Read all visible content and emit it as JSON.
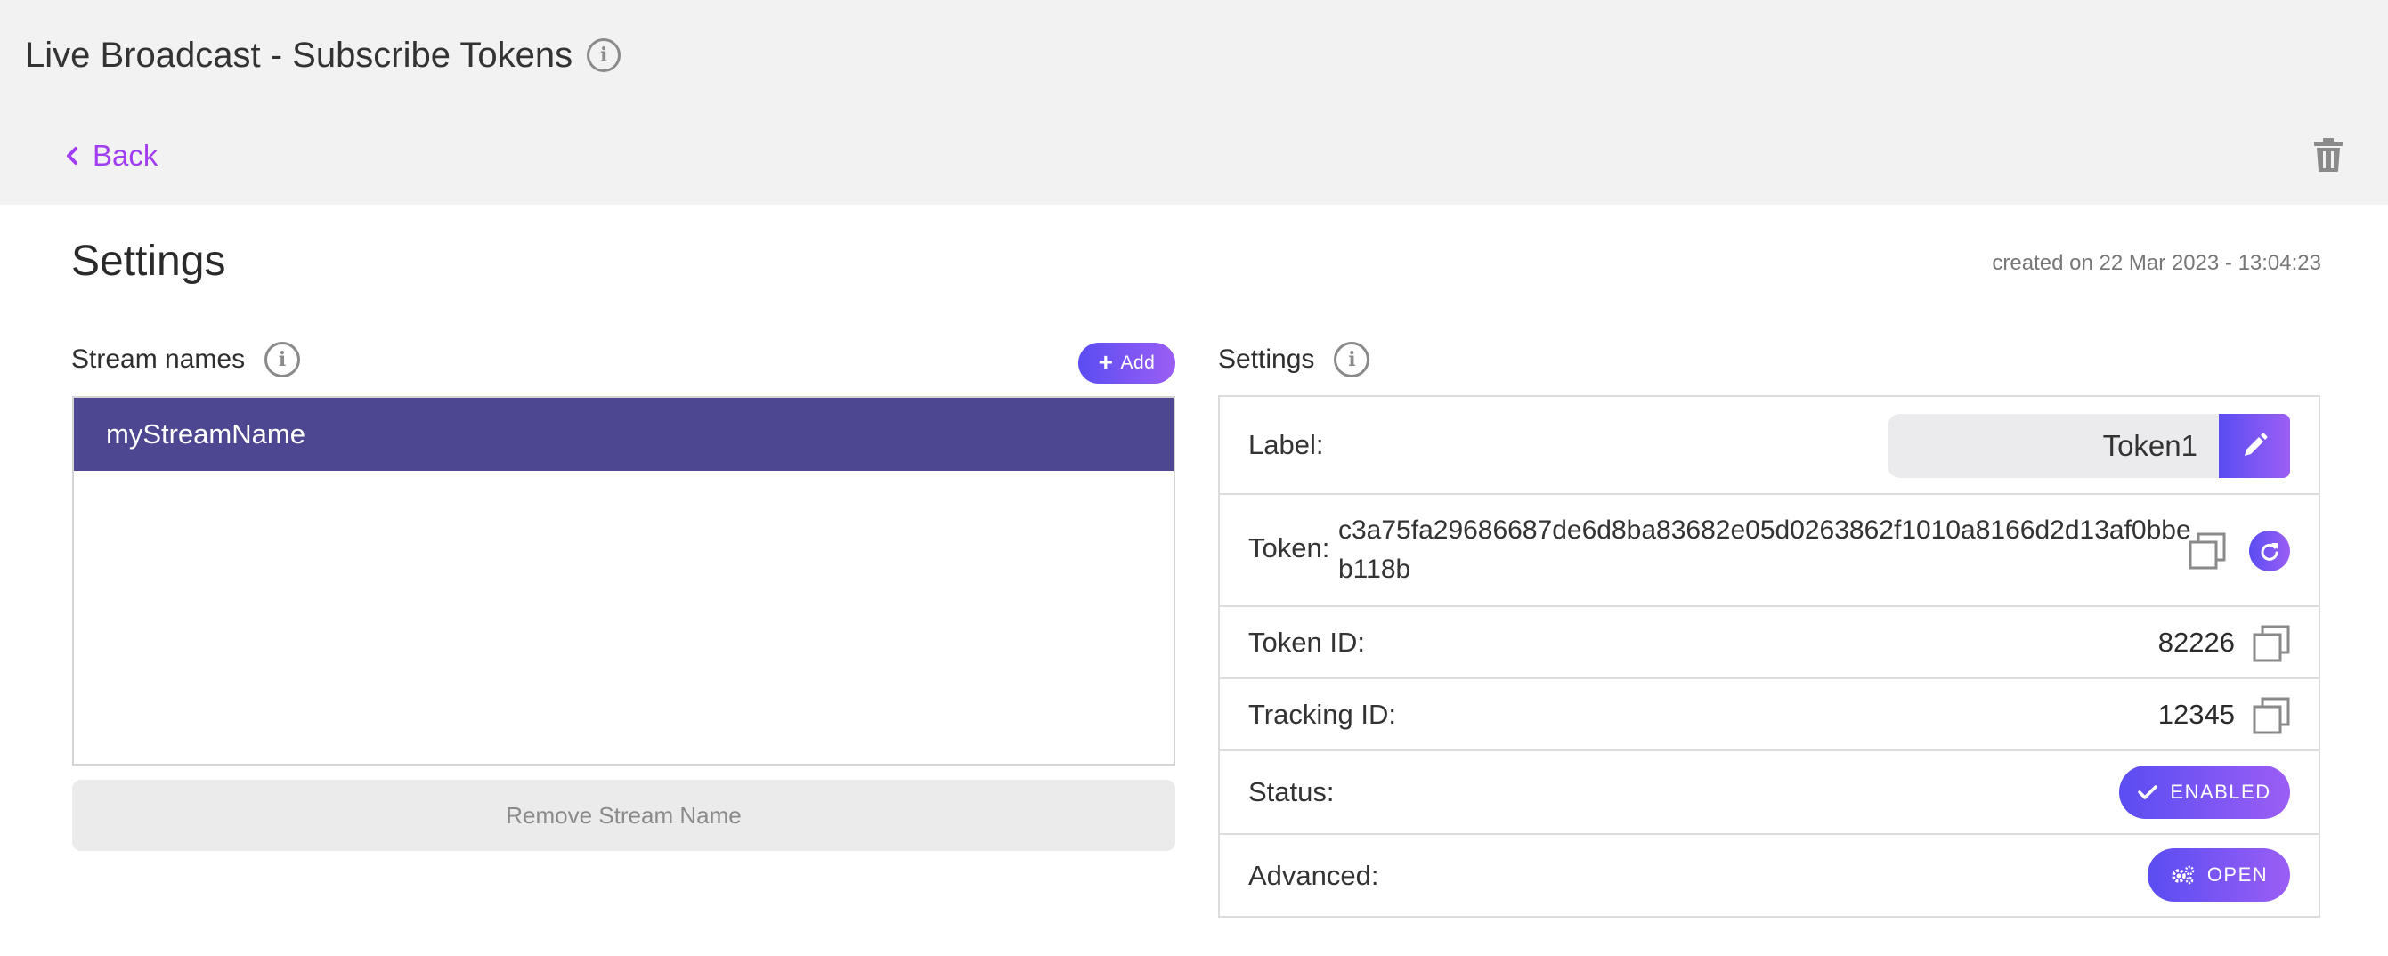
{
  "header": {
    "title": "Live Broadcast - Subscribe Tokens",
    "back_label": "Back"
  },
  "page": {
    "section_title": "Settings",
    "created": "created on 22 Mar 2023 - 13:04:23"
  },
  "stream_names": {
    "title": "Stream names",
    "add_label": "Add",
    "items": [
      "myStreamName"
    ],
    "remove_label": "Remove Stream Name"
  },
  "settings": {
    "title": "Settings",
    "label_label": "Label:",
    "label_value": "Token1",
    "token_label": "Token:",
    "token_value": "c3a75fa29686687de6d8ba83682e05d0263862f1010a8166d2d13af0bbeb118b",
    "token_id_label": "Token ID:",
    "token_id_value": "82226",
    "tracking_id_label": "Tracking ID:",
    "tracking_id_value": "12345",
    "status_label": "Status:",
    "status_value": "ENABLED",
    "advanced_label": "Advanced:",
    "advanced_value": "OPEN"
  },
  "colors": {
    "accent_start": "#5a4df2",
    "accent_end": "#9b5ef5",
    "back_link": "#a23ef2",
    "selected_row": "#4d4691"
  }
}
